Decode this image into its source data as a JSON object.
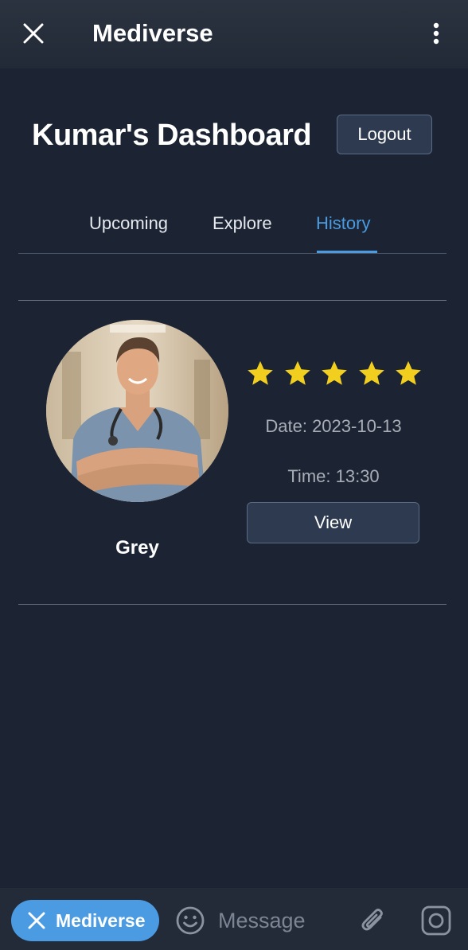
{
  "app": {
    "title": "Mediverse"
  },
  "dashboard": {
    "title": "Kumar's Dashboard",
    "logout_label": "Logout"
  },
  "tabs": [
    {
      "label": "Upcoming",
      "active": false
    },
    {
      "label": "Explore",
      "active": false
    },
    {
      "label": "History",
      "active": true
    }
  ],
  "appointment": {
    "doctor_name": "Grey",
    "rating": 5,
    "rating_max": 5,
    "date": "Date: 2023-10-13",
    "time": "Time: 13:30",
    "view_label": "View"
  },
  "bottom_bar": {
    "pill_label": "Mediverse",
    "message_placeholder": "Message"
  },
  "colors": {
    "background": "#1c2434",
    "accent": "#4a9be0",
    "star": "#f2cf1e",
    "button_bg": "#2d3a4f",
    "muted_text": "#a8adb6"
  },
  "icons": {
    "close": "close-icon",
    "menu": "more-vertical-icon",
    "star": "star-icon",
    "emoji": "smiley-icon",
    "attach": "paperclip-icon",
    "camera": "camera-icon"
  }
}
